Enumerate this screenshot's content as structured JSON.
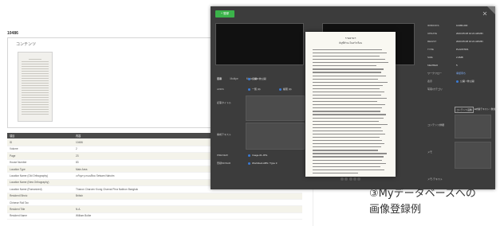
{
  "background_page": {
    "record_id": "10486",
    "section_title": "コンテンツ",
    "table": {
      "header": [
        "項目",
        "内容"
      ],
      "rows": [
        [
          "ID",
          "10486"
        ],
        [
          "Volume",
          "2"
        ],
        [
          "Page",
          "23"
        ],
        [
          "House Number",
          "83"
        ],
        [
          "Location Type",
          "Main Area"
        ],
        [
          "Location Name (Old Orthography)",
          "เจริญกรุงถนนสีลม Setsam Naholm"
        ],
        [
          "Location Name (New Orthography)",
          ""
        ],
        [
          "Location Name (Romanized)",
          "Thanon Charoen Krung Charnai Phra Nakhon Bangkok"
        ],
        [
          "Resident Ethnic",
          "British"
        ],
        [
          "Chinese Roll Tax",
          ""
        ],
        [
          "Resident Title",
          "N.A."
        ],
        [
          "Resident Name",
          "William Bolbe"
        ]
      ]
    }
  },
  "modal": {
    "top_button": "+ 登録",
    "form_tabs": [
      "基本",
      "Multipe",
      "Meta/Data"
    ],
    "left_fields": [
      {
        "label": "公開",
        "value": "公開 / 非公開"
      },
      {
        "label": "LINKS",
        "value": "一覧 (4)",
        "extra": "検索 (4)"
      },
      {
        "label": "記事タイトル",
        "value": ""
      },
      {
        "label": "構成テキスト",
        "value": ""
      },
      {
        "label": "PREVIEW",
        "value": "Image-01.JPG"
      },
      {
        "label": "登録MONAR",
        "value": "WorkflowLABS / Type 3"
      }
    ],
    "right_fields": [
      {
        "label": "ID/BOOKS",
        "value": "10486-000"
      },
      {
        "label": "UPDATE",
        "value": "2023.05.08 10:21 ADMIN"
      },
      {
        "label": "REGIST",
        "value": "2023.05.08 10:21 ADMIN"
      },
      {
        "label": "TYPE",
        "value": "PLANT/001"
      },
      {
        "label": "SIZE",
        "value": "2.2MB"
      },
      {
        "label": "MEMBER",
        "value": "5"
      },
      {
        "label": "ワークフロー",
        "value": "承認待ち"
      },
      {
        "label": "表示",
        "value": "公開 / 非公開"
      },
      {
        "label": "写真/カテゴリ",
        "value": ""
      },
      {
        "label": "コンテンツ詳細",
        "value": ""
      },
      {
        "label": "メモ",
        "value": ""
      },
      {
        "label": "メモ-テキスト",
        "value": ""
      }
    ],
    "chip_label": "コンテンツ画像",
    "chip_text": "■内容テキスト / 無効化"
  },
  "document": {
    "title": "รายงานฯ",
    "subtitle": "บัญชีสำมะโนครัวเรือน",
    "page_count": 5
  },
  "caption": {
    "line1": "③Myデータベースへの",
    "line2": "画像登録例"
  },
  "colors": {
    "accent_green": "#3bb34a",
    "modal_bg": "#3c3c3c",
    "table_header": "#4a4a4a",
    "table_alt": "#f4f3ea",
    "link_blue": "#3a7bd5"
  }
}
